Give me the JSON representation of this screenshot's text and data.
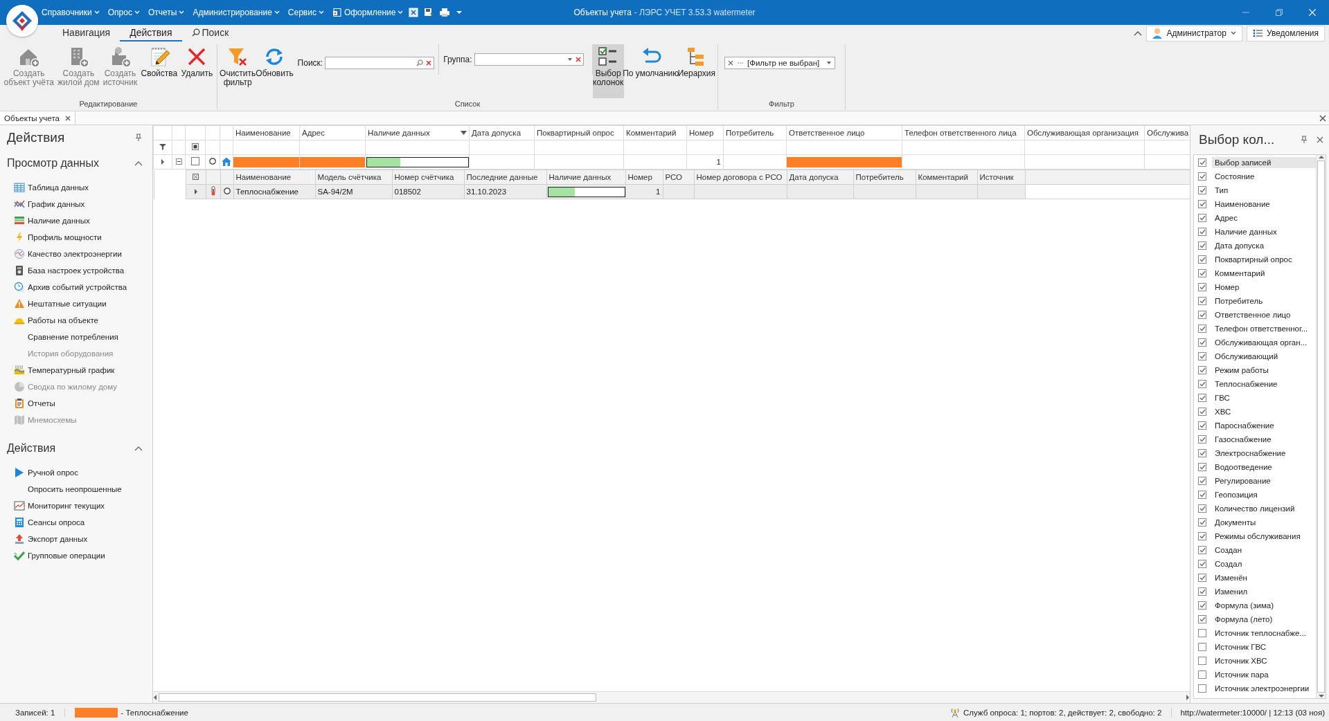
{
  "title_bar": {
    "menu": [
      {
        "label": "Справочники"
      },
      {
        "label": "Опрос"
      },
      {
        "label": "Отчеты"
      },
      {
        "label": "Администрирование"
      },
      {
        "label": "Сервис"
      },
      {
        "label": "Оформление"
      }
    ],
    "document": "Объекты учета",
    "app": "- ЛЭРС УЧЕТ 3.53.3 watermeter"
  },
  "ribbon": {
    "tabs": [
      {
        "label": "Навигация",
        "selected": false
      },
      {
        "label": "Действия",
        "selected": true
      },
      {
        "label": "Поиск",
        "selected": false
      }
    ],
    "user": "Администратор",
    "notifications": "Уведомления",
    "groups": [
      {
        "label": "Редактирование",
        "items": [
          {
            "kind": "button",
            "label": "Создать\nобъект учёта",
            "disabled": true,
            "pressed": false
          },
          {
            "kind": "button",
            "label": "Создать\nжилой дом",
            "disabled": true,
            "pressed": false
          },
          {
            "kind": "button",
            "label": "Создать\nисточник",
            "disabled": true,
            "pressed": false
          },
          {
            "kind": "button",
            "label": "Свойства",
            "disabled": false,
            "pressed": false
          },
          {
            "kind": "button",
            "label": "Удалить",
            "disabled": false,
            "pressed": false
          }
        ]
      },
      {
        "label": "Список",
        "items": [
          {
            "kind": "button",
            "label": "Очистить\nфильтр",
            "disabled": false,
            "pressed": false
          },
          {
            "kind": "button",
            "label": "Обновить",
            "disabled": false,
            "pressed": false
          },
          {
            "kind": "search",
            "label": "Поиск:"
          },
          {
            "kind": "combo",
            "label": "Группа:"
          },
          {
            "kind": "button",
            "label": "Выбор\nколонок",
            "disabled": false,
            "pressed": true
          },
          {
            "kind": "button",
            "label": "По умолчанию",
            "disabled": false,
            "pressed": false
          },
          {
            "kind": "button",
            "label": "Иерархия",
            "disabled": false,
            "pressed": false
          }
        ]
      },
      {
        "label": "Фильтр",
        "items": [
          {
            "kind": "filter",
            "value": "[Фильтр не выбран]"
          }
        ]
      }
    ]
  },
  "doc_tabs": [
    {
      "label": "Объекты учета",
      "selected": true
    }
  ],
  "actions_panel": {
    "title": "Действия",
    "sections": [
      {
        "title": "Просмотр данных",
        "expanded": true,
        "items": [
          {
            "label": "Таблица данных",
            "disabled": false
          },
          {
            "label": "График данных",
            "disabled": false
          },
          {
            "label": "Наличие данных",
            "disabled": false
          },
          {
            "label": "Профиль мощности",
            "disabled": false
          },
          {
            "label": "Качество электроэнергии",
            "disabled": false
          },
          {
            "label": "База настроек устройства",
            "disabled": false
          },
          {
            "label": "Архив событий устройства",
            "disabled": false
          },
          {
            "label": "Нештатные ситуации",
            "disabled": false
          },
          {
            "label": "Работы на объекте",
            "disabled": false
          },
          {
            "label": "Сравнение потребления",
            "disabled": false
          },
          {
            "label": "История оборудования",
            "disabled": true
          },
          {
            "label": "Температурный график",
            "disabled": false
          },
          {
            "label": "Сводка по жилому дому",
            "disabled": true
          },
          {
            "label": "Отчеты",
            "disabled": false
          },
          {
            "label": "Мнемосхемы",
            "disabled": true
          }
        ]
      },
      {
        "title": "Действия",
        "expanded": true,
        "items": [
          {
            "label": "Ручной опрос",
            "disabled": false
          },
          {
            "label": "Опросить неопрошенные",
            "disabled": false
          },
          {
            "label": "Мониторинг текущих",
            "disabled": false
          },
          {
            "label": "Сеансы опроса",
            "disabled": false
          },
          {
            "label": "Экспорт данных",
            "disabled": false
          },
          {
            "label": "Групповые операции",
            "disabled": false
          }
        ]
      }
    ]
  },
  "grid": {
    "select_all_indeterminate": true,
    "columns": [
      {
        "label": "Наименование",
        "sorted": false
      },
      {
        "label": "Адрес",
        "sorted": false
      },
      {
        "label": "Наличие данных",
        "sorted": true
      },
      {
        "label": "Дата допуска",
        "sorted": false
      },
      {
        "label": "Поквартирный опрос",
        "sorted": false
      },
      {
        "label": "Комментарий",
        "sorted": false
      },
      {
        "label": "Номер",
        "sorted": false
      },
      {
        "label": "Потребитель",
        "sorted": false
      },
      {
        "label": "Ответственное лицо",
        "sorted": false
      },
      {
        "label": "Телефон ответственного лица",
        "sorted": false
      },
      {
        "label": "Обслуживающая организация",
        "sorted": false
      },
      {
        "label": "Обслужива",
        "sorted": false
      }
    ],
    "rows": [
      {
        "expanded": true,
        "checked": false,
        "cells": [
          {
            "kind": "masked",
            "color": "#ff7f27"
          },
          {
            "kind": "masked",
            "color": "#ff7f27"
          },
          {
            "kind": "level",
            "level": 0.33
          },
          {
            "kind": "blank"
          },
          {
            "kind": "blank"
          },
          {
            "kind": "blank"
          },
          {
            "kind": "number",
            "text": "1"
          },
          {
            "kind": "blank"
          },
          {
            "kind": "masked",
            "color": "#ff7f27"
          },
          {
            "kind": "blank"
          },
          {
            "kind": "blank"
          },
          {
            "kind": "blank"
          }
        ],
        "detail": {
          "columns": [
            {
              "label": "Наименование"
            },
            {
              "label": "Модель счётчика"
            },
            {
              "label": "Номер счётчика"
            },
            {
              "label": "Последние данные"
            },
            {
              "label": "Наличие данных"
            },
            {
              "label": "Номер"
            },
            {
              "label": "РСО"
            },
            {
              "label": "Номер договора с РСО"
            },
            {
              "label": "Дата допуска"
            },
            {
              "label": "Потребитель"
            },
            {
              "label": "Комментарий"
            },
            {
              "label": "Источник"
            }
          ],
          "rows": [
            {
              "selected": true,
              "cells": [
                {
                  "kind": "text",
                  "text": "Теплоснабжение"
                },
                {
                  "kind": "text",
                  "text": "SA-94/2M"
                },
                {
                  "kind": "text",
                  "text": "018502"
                },
                {
                  "kind": "text",
                  "text": "31.10.2023"
                },
                {
                  "kind": "level",
                  "level": 0.35
                },
                {
                  "kind": "number",
                  "text": "1"
                },
                {
                  "kind": "blank"
                },
                {
                  "kind": "blank"
                },
                {
                  "kind": "blank"
                },
                {
                  "kind": "blank"
                },
                {
                  "kind": "blank"
                },
                {
                  "kind": "blank"
                }
              ]
            }
          ]
        }
      }
    ]
  },
  "column_chooser": {
    "title": "Выбор кол...",
    "items": [
      {
        "label": "Выбор записей",
        "checked": true,
        "selected": true
      },
      {
        "label": "Состояние",
        "checked": true,
        "selected": false
      },
      {
        "label": "Тип",
        "checked": true,
        "selected": false
      },
      {
        "label": "Наименование",
        "checked": true,
        "selected": false
      },
      {
        "label": "Адрес",
        "checked": true,
        "selected": false
      },
      {
        "label": "Наличие данных",
        "checked": true,
        "selected": false
      },
      {
        "label": "Дата допуска",
        "checked": true,
        "selected": false
      },
      {
        "label": "Поквартирный опрос",
        "checked": true,
        "selected": false
      },
      {
        "label": "Комментарий",
        "checked": true,
        "selected": false
      },
      {
        "label": "Номер",
        "checked": true,
        "selected": false
      },
      {
        "label": "Потребитель",
        "checked": true,
        "selected": false
      },
      {
        "label": "Ответственное лицо",
        "checked": true,
        "selected": false
      },
      {
        "label": "Телефон ответственног...",
        "checked": true,
        "selected": false
      },
      {
        "label": "Обслуживающая орган...",
        "checked": true,
        "selected": false
      },
      {
        "label": "Обслуживающий",
        "checked": true,
        "selected": false
      },
      {
        "label": "Режим работы",
        "checked": true,
        "selected": false
      },
      {
        "label": "Теплоснабжение",
        "checked": true,
        "selected": false
      },
      {
        "label": "ГВС",
        "checked": true,
        "selected": false
      },
      {
        "label": "ХВС",
        "checked": true,
        "selected": false
      },
      {
        "label": "Пароснабжение",
        "checked": true,
        "selected": false
      },
      {
        "label": "Газоснабжение",
        "checked": true,
        "selected": false
      },
      {
        "label": "Электроснабжение",
        "checked": true,
        "selected": false
      },
      {
        "label": "Водоотведение",
        "checked": true,
        "selected": false
      },
      {
        "label": "Регулирование",
        "checked": true,
        "selected": false
      },
      {
        "label": "Геопозиция",
        "checked": true,
        "selected": false
      },
      {
        "label": "Количество лицензий",
        "checked": true,
        "selected": false
      },
      {
        "label": "Документы",
        "checked": true,
        "selected": false
      },
      {
        "label": "Режимы обслуживания",
        "checked": true,
        "selected": false
      },
      {
        "label": "Создан",
        "checked": true,
        "selected": false
      },
      {
        "label": "Создал",
        "checked": true,
        "selected": false
      },
      {
        "label": "Изменён",
        "checked": true,
        "selected": false
      },
      {
        "label": "Изменил",
        "checked": true,
        "selected": false
      },
      {
        "label": "Формула (зима)",
        "checked": true,
        "selected": false
      },
      {
        "label": "Формула (лето)",
        "checked": true,
        "selected": false
      },
      {
        "label": "Источник теплоснабже...",
        "checked": false,
        "selected": false
      },
      {
        "label": "Источник ГВС",
        "checked": false,
        "selected": false
      },
      {
        "label": "Источник ХВС",
        "checked": false,
        "selected": false
      },
      {
        "label": "Источник пара",
        "checked": false,
        "selected": false
      },
      {
        "label": "Источник электроэнергии",
        "checked": false,
        "selected": false
      }
    ]
  },
  "status_bar": {
    "records": "Записей: 1",
    "legend": [
      {
        "color": "#ff7f27",
        "label": "- Теплоснабжение"
      }
    ],
    "services": "Служб опроса: 1; портов: 2, действует: 2, свободно: 2",
    "server": "http://watermeter:10000/ | 12:13 (03 ноя)"
  }
}
